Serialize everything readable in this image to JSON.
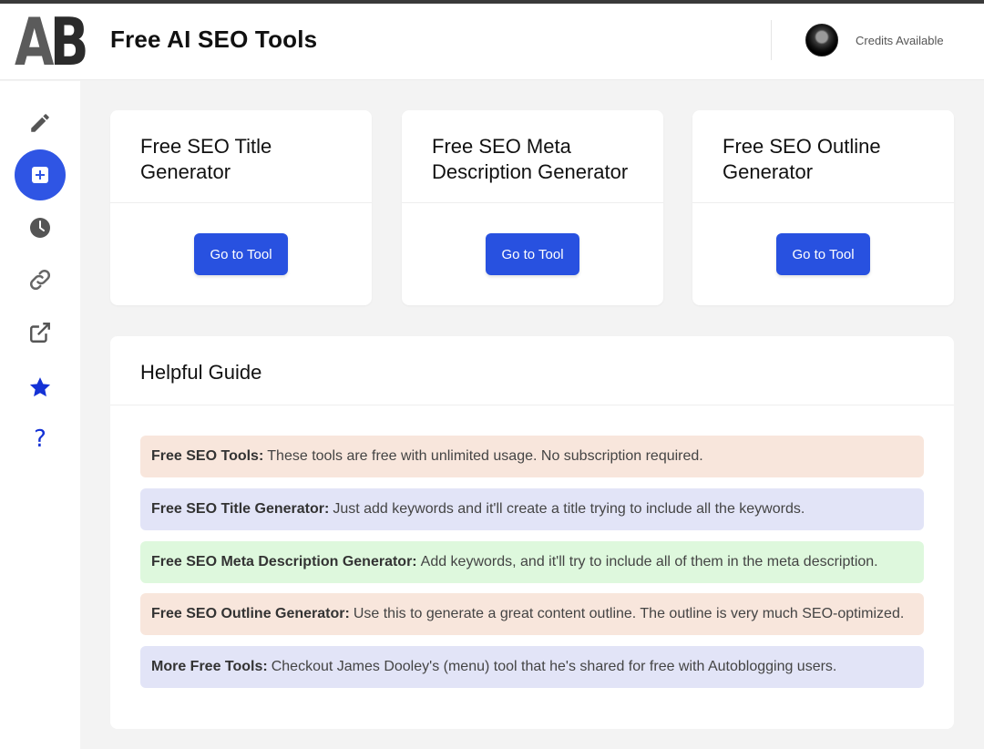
{
  "header": {
    "logo_text_a": "A",
    "logo_text_b": "B",
    "title": "Free AI SEO Tools",
    "credits_label": "Credits Available"
  },
  "sidebar": {
    "items": [
      {
        "icon": "pencil-icon"
      },
      {
        "icon": "plus-square-icon",
        "active": true
      },
      {
        "icon": "clock-icon"
      },
      {
        "icon": "link-icon"
      },
      {
        "icon": "external-link-icon"
      },
      {
        "icon": "star-icon"
      },
      {
        "icon": "question-icon",
        "glyph": "?"
      }
    ]
  },
  "tools": [
    {
      "title_line1": "Free SEO Title",
      "title_line2": "Generator",
      "button": "Go to Tool"
    },
    {
      "title_line1": "Free SEO Meta",
      "title_line2": "Description Generator",
      "button": "Go to Tool"
    },
    {
      "title_line1": "Free SEO Outline",
      "title_line2": "Generator",
      "button": "Go to Tool"
    }
  ],
  "guide": {
    "title": "Helpful Guide",
    "notes": [
      {
        "label": "Free SEO Tools:",
        "text": "These tools are free with unlimited usage. No subscription required."
      },
      {
        "label": "Free SEO Title Generator:",
        "text": "Just add keywords and it'll create a title trying to include all the keywords."
      },
      {
        "label": "Free SEO Meta Description Generator:",
        "text": "Add keywords, and it'll try to include all of them in the meta description."
      },
      {
        "label": "Free SEO Outline Generator:",
        "text": "Use this to generate a great content outline. The outline is very much SEO-optimized."
      },
      {
        "label": "More Free Tools:",
        "text": "Checkout James Dooley's (menu) tool that he's shared for free with Autoblogging users."
      }
    ]
  },
  "colors": {
    "accent": "#2851e0",
    "sidebar_active": "#2f55e4",
    "peach": "#f8e6dc",
    "lavender": "#e2e4f7",
    "mint": "#def8dd"
  }
}
